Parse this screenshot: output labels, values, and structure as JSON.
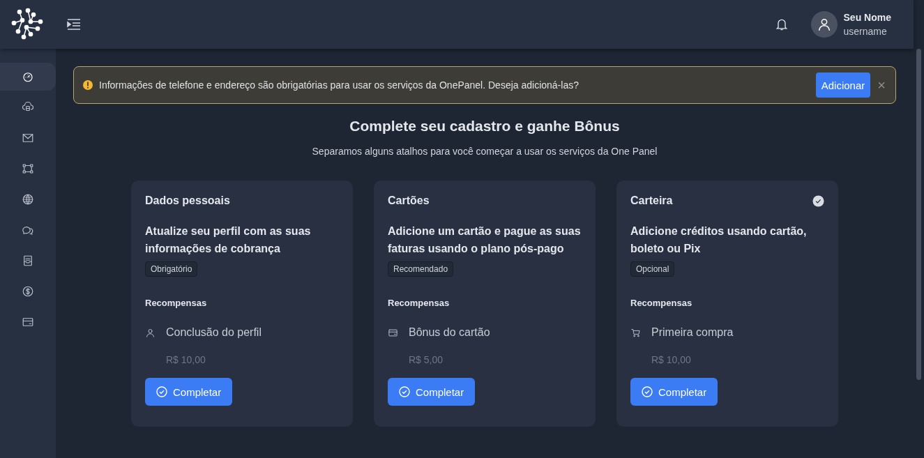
{
  "header": {
    "user": {
      "name": "Seu Nome",
      "username": "username"
    }
  },
  "sidebar": {
    "items": [
      {
        "kind": "gauge",
        "selected": true
      },
      {
        "kind": "cloud",
        "selected": false
      },
      {
        "kind": "mail",
        "selected": false
      },
      {
        "kind": "frame",
        "selected": false
      },
      {
        "kind": "globe",
        "selected": false
      },
      {
        "kind": "chat",
        "selected": false
      },
      {
        "kind": "receipt",
        "selected": false
      },
      {
        "kind": "dollar",
        "selected": false
      },
      {
        "kind": "card",
        "selected": false
      }
    ]
  },
  "alert": {
    "message": "Informações de telefone e endereço são obrigatórias para usar os serviços da OnePanel. Deseja adicioná-las?",
    "action": "Adicionar",
    "close": "×"
  },
  "title": "Complete seu cadastro e ganhe Bônus",
  "subtitle": "Separamos alguns atalhos para você começar a usar os serviços da One Panel",
  "cards": [
    {
      "title": "Dados pessoais",
      "completed": false,
      "description": "Atualize seu perfil com as suas informações de cobrança",
      "tag": "Obrigatório",
      "rewards_label": "Recompensas",
      "reward": {
        "kind": "user",
        "name": "Conclusão do perfil",
        "amount": "R$ 10,00"
      },
      "button": "Completar"
    },
    {
      "title": "Cartões",
      "completed": false,
      "description": "Adicione um cartão e pague as suas faturas usando o plano pós-pago",
      "tag": "Recomendado",
      "rewards_label": "Recompensas",
      "reward": {
        "kind": "card",
        "name": "Bônus do cartão",
        "amount": "R$ 5,00"
      },
      "button": "Completar"
    },
    {
      "title": "Carteira",
      "completed": true,
      "description": "Adicione créditos usando cartão, boleto ou Pix",
      "tag": "Opcional",
      "rewards_label": "Recompensas",
      "reward": {
        "kind": "cart",
        "name": "Primeira compra",
        "amount": "R$ 10,00"
      },
      "button": "Completar"
    }
  ]
}
